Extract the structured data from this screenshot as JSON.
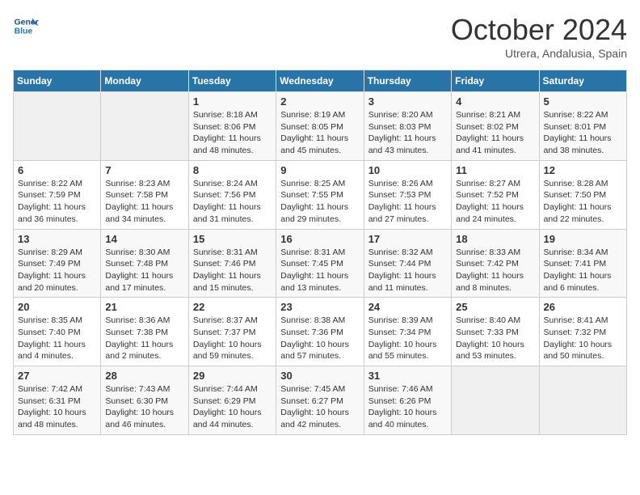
{
  "logo": {
    "text_general": "General",
    "text_blue": "Blue"
  },
  "title": "October 2024",
  "location": "Utrera, Andalusia, Spain",
  "days_of_week": [
    "Sunday",
    "Monday",
    "Tuesday",
    "Wednesday",
    "Thursday",
    "Friday",
    "Saturday"
  ],
  "weeks": [
    [
      {
        "day": "",
        "info": ""
      },
      {
        "day": "",
        "info": ""
      },
      {
        "day": "1",
        "info": "Sunrise: 8:18 AM\nSunset: 8:06 PM\nDaylight: 11 hours and 48 minutes."
      },
      {
        "day": "2",
        "info": "Sunrise: 8:19 AM\nSunset: 8:05 PM\nDaylight: 11 hours and 45 minutes."
      },
      {
        "day": "3",
        "info": "Sunrise: 8:20 AM\nSunset: 8:03 PM\nDaylight: 11 hours and 43 minutes."
      },
      {
        "day": "4",
        "info": "Sunrise: 8:21 AM\nSunset: 8:02 PM\nDaylight: 11 hours and 41 minutes."
      },
      {
        "day": "5",
        "info": "Sunrise: 8:22 AM\nSunset: 8:01 PM\nDaylight: 11 hours and 38 minutes."
      }
    ],
    [
      {
        "day": "6",
        "info": "Sunrise: 8:22 AM\nSunset: 7:59 PM\nDaylight: 11 hours and 36 minutes."
      },
      {
        "day": "7",
        "info": "Sunrise: 8:23 AM\nSunset: 7:58 PM\nDaylight: 11 hours and 34 minutes."
      },
      {
        "day": "8",
        "info": "Sunrise: 8:24 AM\nSunset: 7:56 PM\nDaylight: 11 hours and 31 minutes."
      },
      {
        "day": "9",
        "info": "Sunrise: 8:25 AM\nSunset: 7:55 PM\nDaylight: 11 hours and 29 minutes."
      },
      {
        "day": "10",
        "info": "Sunrise: 8:26 AM\nSunset: 7:53 PM\nDaylight: 11 hours and 27 minutes."
      },
      {
        "day": "11",
        "info": "Sunrise: 8:27 AM\nSunset: 7:52 PM\nDaylight: 11 hours and 24 minutes."
      },
      {
        "day": "12",
        "info": "Sunrise: 8:28 AM\nSunset: 7:50 PM\nDaylight: 11 hours and 22 minutes."
      }
    ],
    [
      {
        "day": "13",
        "info": "Sunrise: 8:29 AM\nSunset: 7:49 PM\nDaylight: 11 hours and 20 minutes."
      },
      {
        "day": "14",
        "info": "Sunrise: 8:30 AM\nSunset: 7:48 PM\nDaylight: 11 hours and 17 minutes."
      },
      {
        "day": "15",
        "info": "Sunrise: 8:31 AM\nSunset: 7:46 PM\nDaylight: 11 hours and 15 minutes."
      },
      {
        "day": "16",
        "info": "Sunrise: 8:31 AM\nSunset: 7:45 PM\nDaylight: 11 hours and 13 minutes."
      },
      {
        "day": "17",
        "info": "Sunrise: 8:32 AM\nSunset: 7:44 PM\nDaylight: 11 hours and 11 minutes."
      },
      {
        "day": "18",
        "info": "Sunrise: 8:33 AM\nSunset: 7:42 PM\nDaylight: 11 hours and 8 minutes."
      },
      {
        "day": "19",
        "info": "Sunrise: 8:34 AM\nSunset: 7:41 PM\nDaylight: 11 hours and 6 minutes."
      }
    ],
    [
      {
        "day": "20",
        "info": "Sunrise: 8:35 AM\nSunset: 7:40 PM\nDaylight: 11 hours and 4 minutes."
      },
      {
        "day": "21",
        "info": "Sunrise: 8:36 AM\nSunset: 7:38 PM\nDaylight: 11 hours and 2 minutes."
      },
      {
        "day": "22",
        "info": "Sunrise: 8:37 AM\nSunset: 7:37 PM\nDaylight: 10 hours and 59 minutes."
      },
      {
        "day": "23",
        "info": "Sunrise: 8:38 AM\nSunset: 7:36 PM\nDaylight: 10 hours and 57 minutes."
      },
      {
        "day": "24",
        "info": "Sunrise: 8:39 AM\nSunset: 7:34 PM\nDaylight: 10 hours and 55 minutes."
      },
      {
        "day": "25",
        "info": "Sunrise: 8:40 AM\nSunset: 7:33 PM\nDaylight: 10 hours and 53 minutes."
      },
      {
        "day": "26",
        "info": "Sunrise: 8:41 AM\nSunset: 7:32 PM\nDaylight: 10 hours and 50 minutes."
      }
    ],
    [
      {
        "day": "27",
        "info": "Sunrise: 7:42 AM\nSunset: 6:31 PM\nDaylight: 10 hours and 48 minutes."
      },
      {
        "day": "28",
        "info": "Sunrise: 7:43 AM\nSunset: 6:30 PM\nDaylight: 10 hours and 46 minutes."
      },
      {
        "day": "29",
        "info": "Sunrise: 7:44 AM\nSunset: 6:29 PM\nDaylight: 10 hours and 44 minutes."
      },
      {
        "day": "30",
        "info": "Sunrise: 7:45 AM\nSunset: 6:27 PM\nDaylight: 10 hours and 42 minutes."
      },
      {
        "day": "31",
        "info": "Sunrise: 7:46 AM\nSunset: 6:26 PM\nDaylight: 10 hours and 40 minutes."
      },
      {
        "day": "",
        "info": ""
      },
      {
        "day": "",
        "info": ""
      }
    ]
  ]
}
